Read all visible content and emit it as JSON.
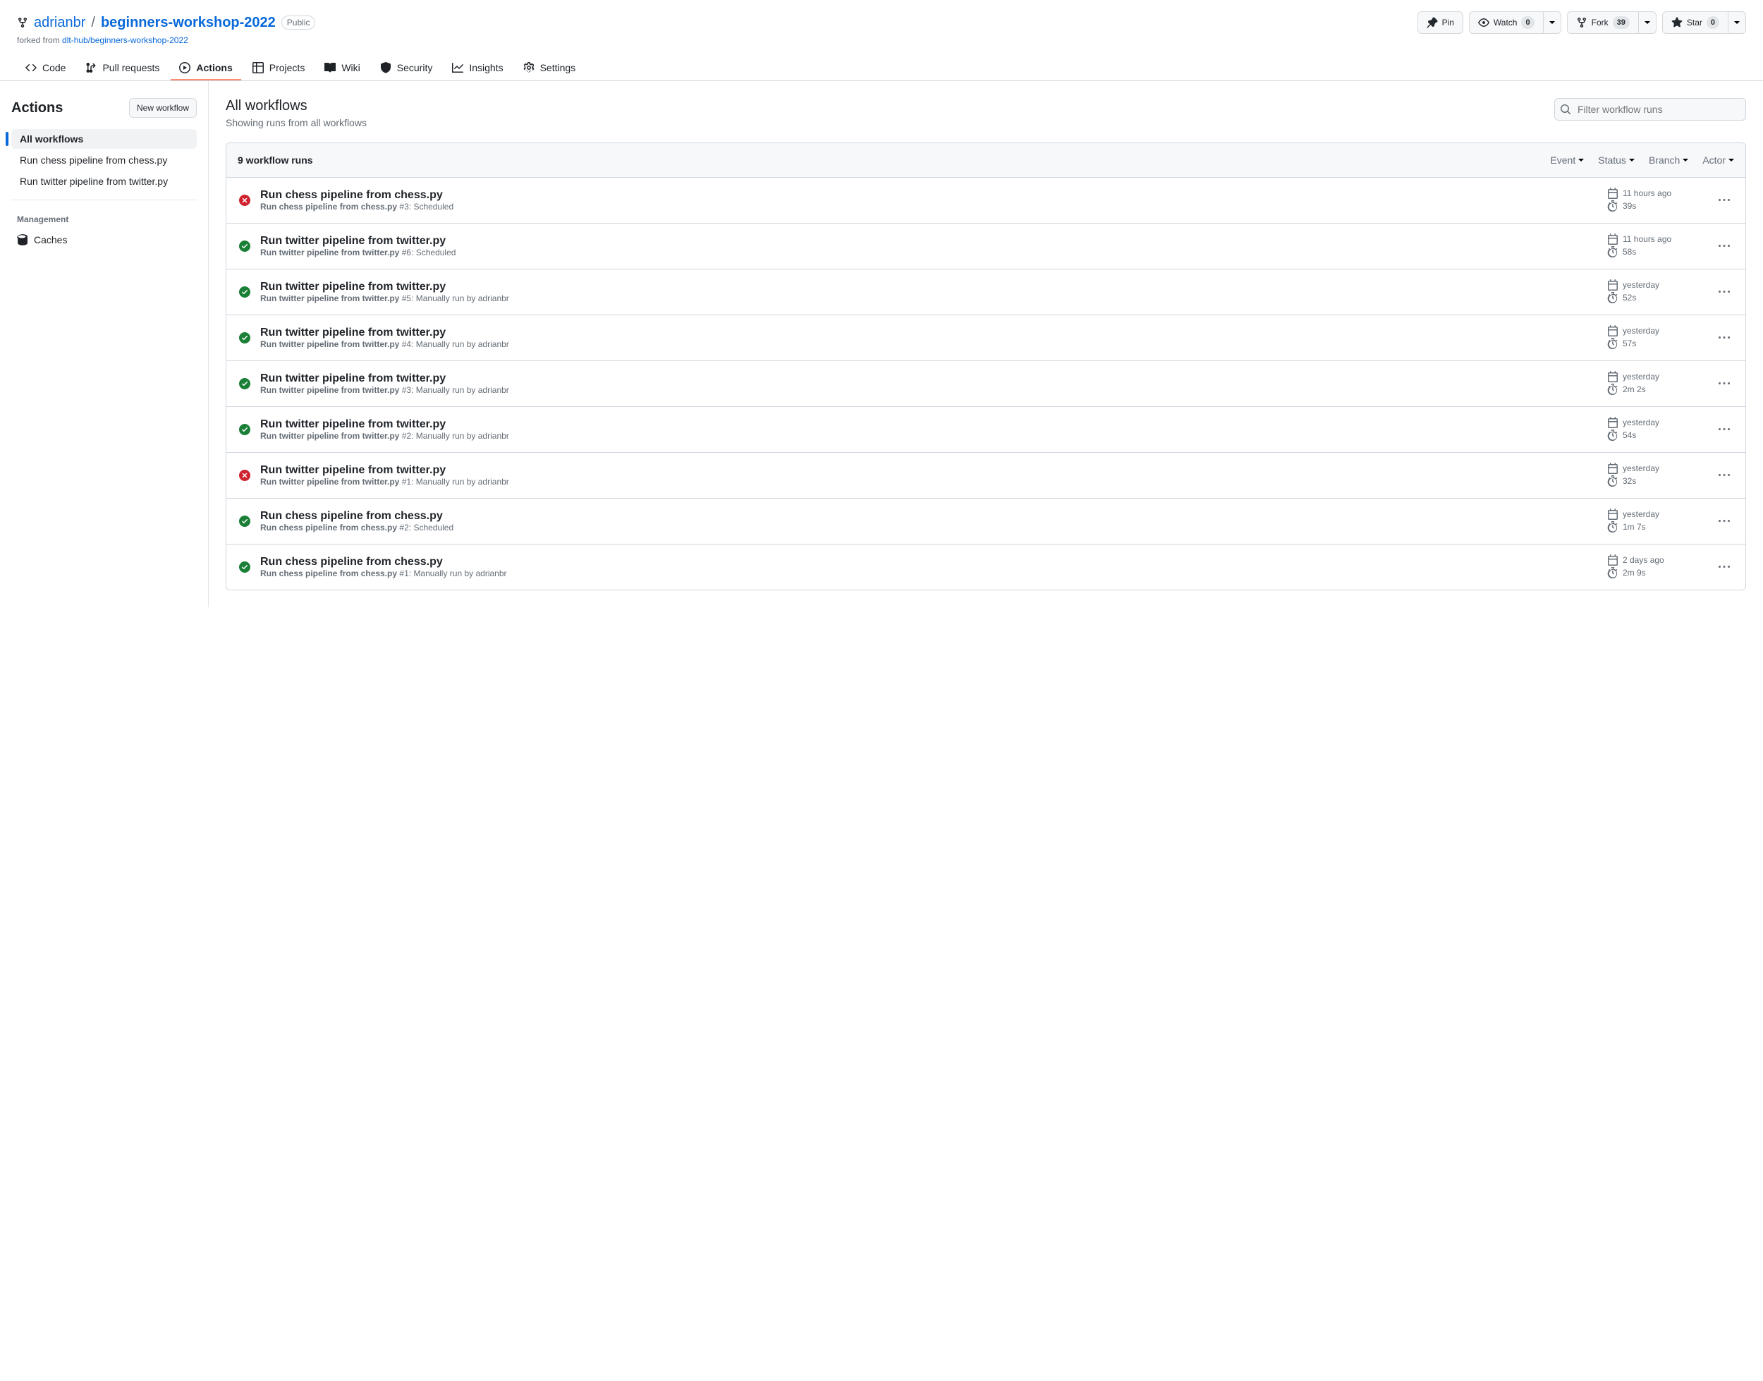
{
  "repo": {
    "owner": "adrianbr",
    "name": "beginners-workshop-2022",
    "visibility": "Public",
    "forked_prefix": "forked from ",
    "forked_from": "dlt-hub/beginners-workshop-2022"
  },
  "actions": {
    "pin": "Pin",
    "watch": "Watch",
    "watch_count": "0",
    "fork": "Fork",
    "fork_count": "39",
    "star": "Star",
    "star_count": "0"
  },
  "nav": {
    "code": "Code",
    "pulls": "Pull requests",
    "actions": "Actions",
    "projects": "Projects",
    "wiki": "Wiki",
    "security": "Security",
    "insights": "Insights",
    "settings": "Settings"
  },
  "sidebar": {
    "title": "Actions",
    "new_workflow": "New workflow",
    "all_workflows": "All workflows",
    "workflows": [
      "Run chess pipeline from chess.py",
      "Run twitter pipeline from twitter.py"
    ],
    "management": "Management",
    "caches": "Caches"
  },
  "main": {
    "title": "All workflows",
    "subtitle": "Showing runs from all workflows",
    "search_placeholder": "Filter workflow runs",
    "run_count_label": "9 workflow runs",
    "filters": {
      "event": "Event",
      "status": "Status",
      "branch": "Branch",
      "actor": "Actor"
    }
  },
  "runs": [
    {
      "status": "fail",
      "title": "Run chess pipeline from chess.py",
      "wf": "Run chess pipeline from chess.py",
      "num": "#3",
      "trigger": "Scheduled",
      "time": "11 hours ago",
      "dur": "39s"
    },
    {
      "status": "success",
      "title": "Run twitter pipeline from twitter.py",
      "wf": "Run twitter pipeline from twitter.py",
      "num": "#6",
      "trigger": "Scheduled",
      "time": "11 hours ago",
      "dur": "58s"
    },
    {
      "status": "success",
      "title": "Run twitter pipeline from twitter.py",
      "wf": "Run twitter pipeline from twitter.py",
      "num": "#5",
      "trigger": "Manually run by adrianbr",
      "time": "yesterday",
      "dur": "52s"
    },
    {
      "status": "success",
      "title": "Run twitter pipeline from twitter.py",
      "wf": "Run twitter pipeline from twitter.py",
      "num": "#4",
      "trigger": "Manually run by adrianbr",
      "time": "yesterday",
      "dur": "57s"
    },
    {
      "status": "success",
      "title": "Run twitter pipeline from twitter.py",
      "wf": "Run twitter pipeline from twitter.py",
      "num": "#3",
      "trigger": "Manually run by adrianbr",
      "time": "yesterday",
      "dur": "2m 2s"
    },
    {
      "status": "success",
      "title": "Run twitter pipeline from twitter.py",
      "wf": "Run twitter pipeline from twitter.py",
      "num": "#2",
      "trigger": "Manually run by adrianbr",
      "time": "yesterday",
      "dur": "54s"
    },
    {
      "status": "fail",
      "title": "Run twitter pipeline from twitter.py",
      "wf": "Run twitter pipeline from twitter.py",
      "num": "#1",
      "trigger": "Manually run by adrianbr",
      "time": "yesterday",
      "dur": "32s"
    },
    {
      "status": "success",
      "title": "Run chess pipeline from chess.py",
      "wf": "Run chess pipeline from chess.py",
      "num": "#2",
      "trigger": "Scheduled",
      "time": "yesterday",
      "dur": "1m 7s"
    },
    {
      "status": "success",
      "title": "Run chess pipeline from chess.py",
      "wf": "Run chess pipeline from chess.py",
      "num": "#1",
      "trigger": "Manually run by adrianbr",
      "time": "2 days ago",
      "dur": "2m 9s"
    }
  ]
}
